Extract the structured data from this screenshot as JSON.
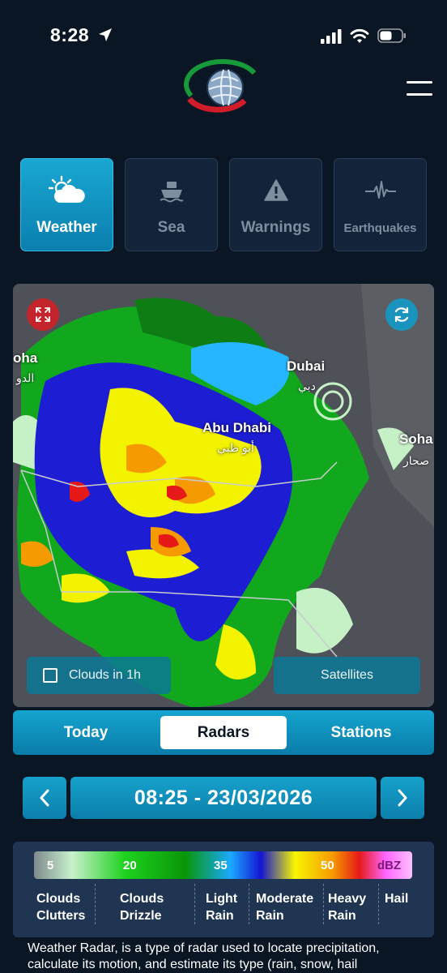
{
  "status": {
    "time": "8:28"
  },
  "categories": [
    {
      "label": "Weather",
      "icon": "partly-cloudy-icon",
      "active": true
    },
    {
      "label": "Sea",
      "icon": "ship-icon",
      "active": false
    },
    {
      "label": "Warnings",
      "icon": "warning-icon",
      "active": false
    },
    {
      "label": "Earthquakes",
      "icon": "seismograph-icon",
      "active": false
    }
  ],
  "map": {
    "labels": {
      "doha": "oha",
      "doha_ar": "الدو",
      "dubai": "Dubai",
      "dubai_ar": "دبي",
      "abudhabi": "Abu Dhabi",
      "abudhabi_ar": "أبو ظبي",
      "sohar": "Soha",
      "sohar_ar": "صحار"
    },
    "clouds_label": "Clouds in 1h",
    "satellites_label": "Satellites"
  },
  "subtabs": {
    "today": "Today",
    "radars": "Radars",
    "stations": "Stations",
    "active": "Radars"
  },
  "date_nav": {
    "value": "08:25 - 23/03/2026"
  },
  "legend": {
    "scale": [
      "5",
      "20",
      "35",
      "50",
      "dBZ"
    ],
    "columns": [
      [
        "Clouds",
        "Clutters"
      ],
      [
        "Clouds",
        "Drizzle"
      ],
      [
        "Light",
        "Rain"
      ],
      [
        "Moderate",
        "Rain"
      ],
      [
        "Heavy",
        "Rain"
      ],
      [
        "Hail"
      ]
    ]
  },
  "description": "Weather Radar, is a type of radar used to locate precipitation, calculate its motion, and estimate its type (rain, snow, hail",
  "colors": {
    "accent": "#1aa7d3",
    "background": "#0b1624",
    "danger": "#c4242c"
  }
}
